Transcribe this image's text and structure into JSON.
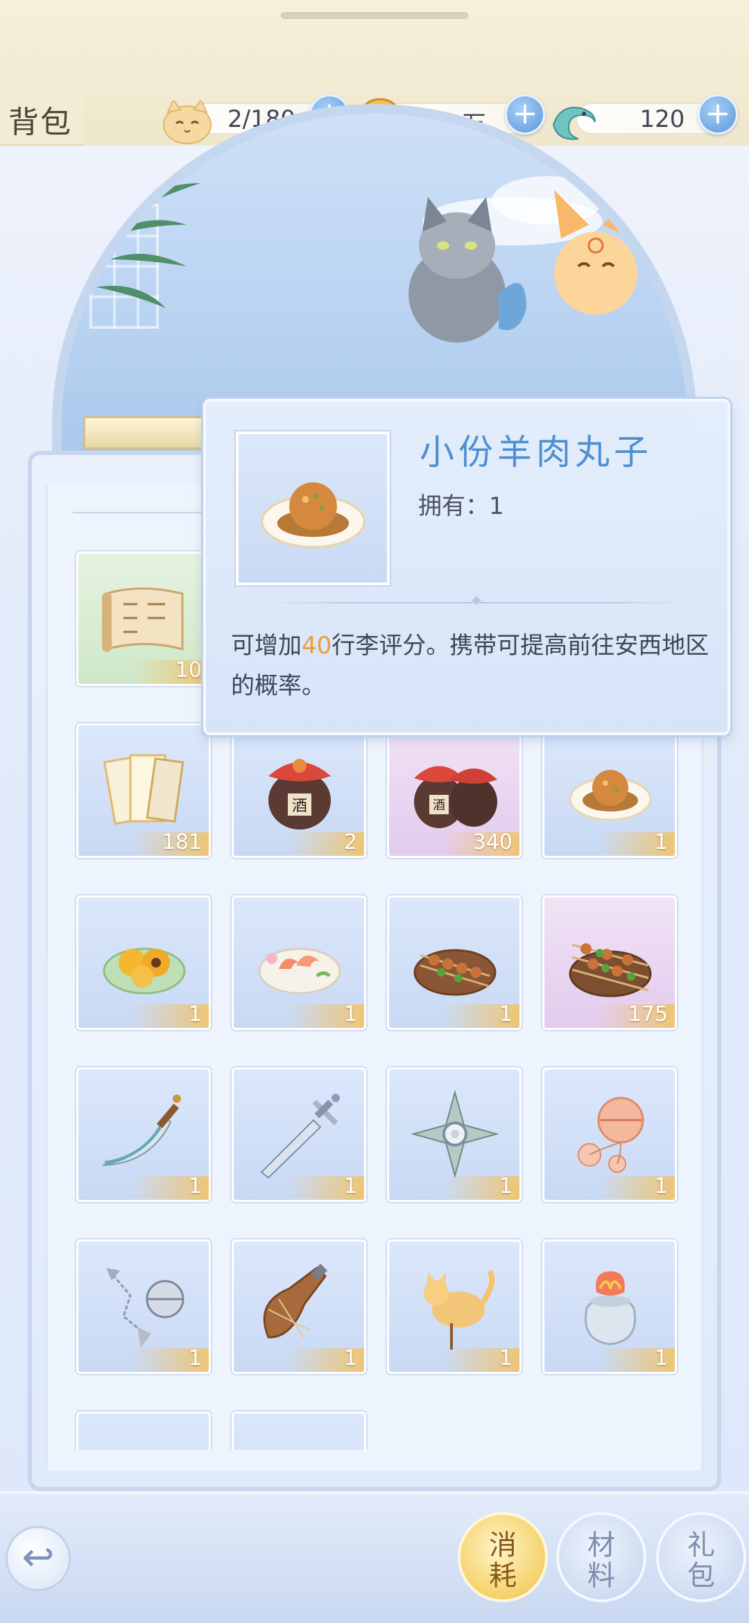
{
  "header": {
    "title": "背包",
    "capacity": "2/180",
    "coins": "56万",
    "jade": "120"
  },
  "popup": {
    "item_name": "小份羊肉丸子",
    "owned_label": "拥有：1",
    "desc_pre": "可增加",
    "desc_highlight": "40",
    "desc_post": "行李评分。携带可提高前往安西地区的概率。"
  },
  "inventory": [
    {
      "name": "book-scroll",
      "count": "10"
    },
    {
      "name": "fortune-cards",
      "count": "181"
    },
    {
      "name": "wine-jar",
      "count": "2"
    },
    {
      "name": "wine-jars-double",
      "count": "340"
    },
    {
      "name": "lamb-meatball",
      "count": "1"
    },
    {
      "name": "apricot-dish",
      "count": "1"
    },
    {
      "name": "shrimp-dish",
      "count": "1"
    },
    {
      "name": "skewers-plate",
      "count": "1"
    },
    {
      "name": "skewers-plate-large",
      "count": "175"
    },
    {
      "name": "broadsword",
      "count": "1"
    },
    {
      "name": "short-sword",
      "count": "1"
    },
    {
      "name": "shuriken",
      "count": "1"
    },
    {
      "name": "bells",
      "count": "1"
    },
    {
      "name": "meteor-hammer",
      "count": "1"
    },
    {
      "name": "wine-gourd",
      "count": "1"
    },
    {
      "name": "cat-candy",
      "count": "1"
    },
    {
      "name": "flower-jar",
      "count": "1"
    }
  ],
  "tabs": [
    {
      "label": "消耗",
      "active": true
    },
    {
      "label": "材料",
      "active": false
    },
    {
      "label": "礼包",
      "active": false
    }
  ],
  "icons": {
    "back": "back-arrow-icon",
    "plus": "plus-icon",
    "capacity": "cat-face-icon",
    "coin": "coin-icon",
    "jade": "jade-fish-icon"
  },
  "colors": {
    "accent_blue": "#4e8fd1",
    "highlight_orange": "#f09a3c",
    "count_bar": "#f0c46e",
    "active_tab": "#f4d26a"
  }
}
